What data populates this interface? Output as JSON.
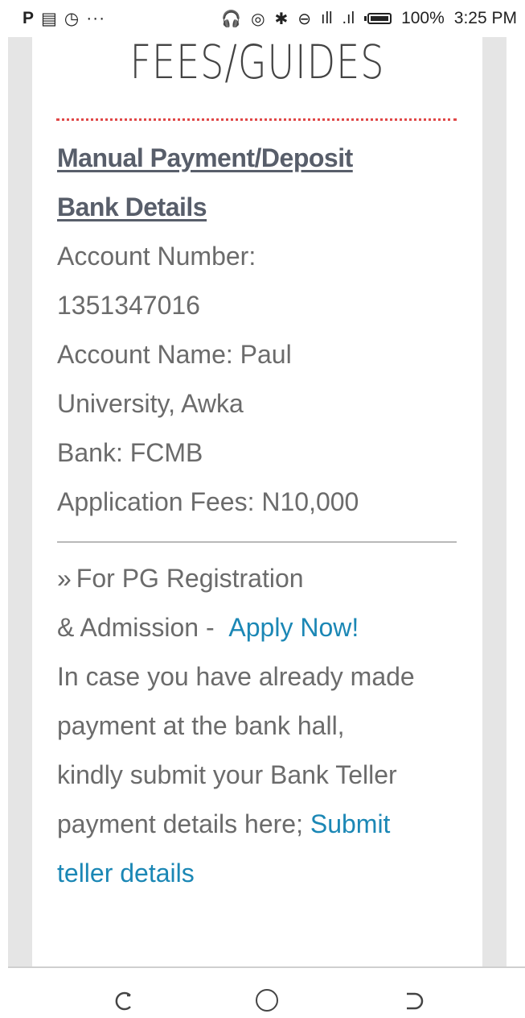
{
  "status_bar": {
    "left_icons": [
      "P",
      "▤",
      "◷",
      "···"
    ],
    "right_icons": [
      "🎧",
      "◎",
      "✱",
      "⊖",
      "Ⅲ",
      "ıll"
    ],
    "battery": "100%",
    "time": "3:25 PM"
  },
  "page": {
    "title": "FEES/GUIDES",
    "heading_line1": "Manual Payment/Deposit",
    "heading_line2": "Bank Details",
    "account_number_label": "Account Number:",
    "account_number_value": "1351347016",
    "account_name_line1": "Account Name: Paul",
    "account_name_line2": "University, Awka",
    "bank": "Bank: FCMB",
    "application_fees": "Application Fees: N10,000",
    "pg_bullet": "»",
    "pg_line1": "For PG Registration",
    "pg_line2_prefix": "& Admission - ",
    "apply_link": "Apply Now!",
    "teller_line1": "In case you have already made",
    "teller_line2": "payment at the bank hall,",
    "teller_line3": "kindly submit your Bank Teller",
    "teller_line4_prefix": "payment details here; ",
    "submit_link_line1": "Submit",
    "submit_link_line2": "teller details"
  },
  "navbar": {
    "back_icon": "back-icon",
    "home_icon": "home-icon",
    "recents_icon": "recents-icon"
  },
  "colors": {
    "link": "#1b87b5",
    "heading": "#585e6a",
    "body_text": "#6b6b6b",
    "dotted_rule": "#e04848",
    "side_strip": "#e5e5e5"
  }
}
